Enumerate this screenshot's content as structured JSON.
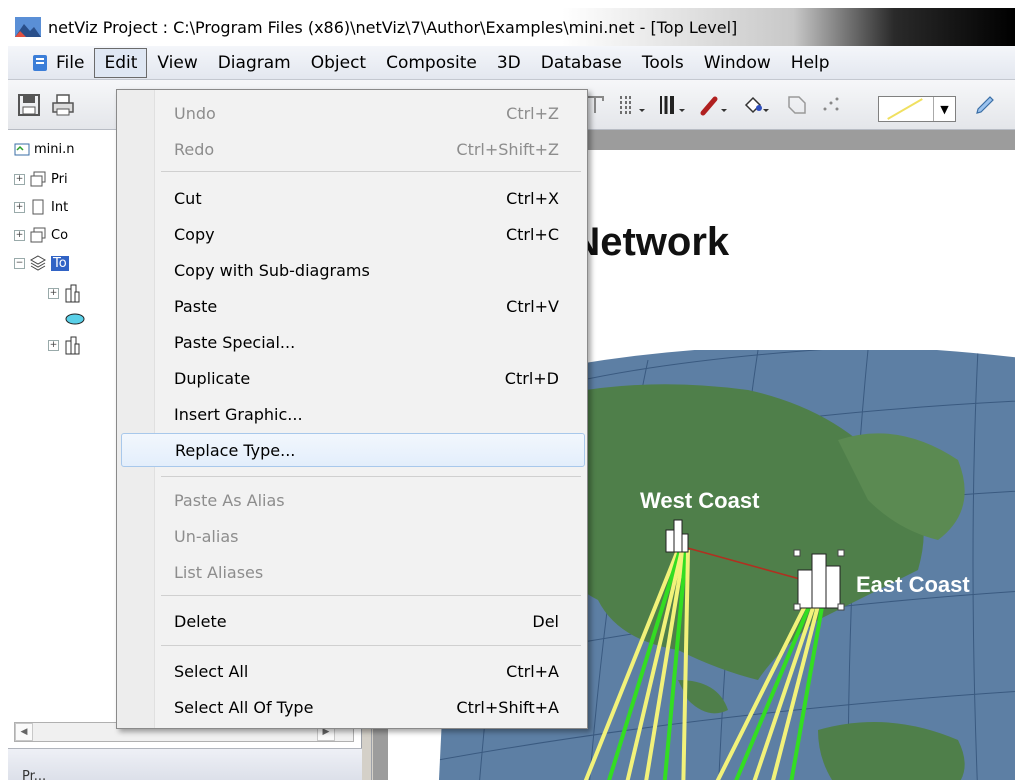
{
  "window": {
    "title": "netViz Project : C:\\Program Files (x86)\\netViz\\7\\Author\\Examples\\mini.net - [Top Level]"
  },
  "menubar": {
    "items": [
      "File",
      "Edit",
      "View",
      "Diagram",
      "Object",
      "Composite",
      "3D",
      "Database",
      "Tools",
      "Window",
      "Help"
    ],
    "open_item": "Edit"
  },
  "edit_menu": {
    "items": [
      {
        "label": "Undo",
        "shortcut": "Ctrl+Z",
        "enabled": false
      },
      {
        "label": "Redo",
        "shortcut": "Ctrl+Shift+Z",
        "enabled": false
      },
      {
        "label": "Cut",
        "shortcut": "Ctrl+X",
        "enabled": true
      },
      {
        "label": "Copy",
        "shortcut": "Ctrl+C",
        "enabled": true
      },
      {
        "label": "Copy with Sub-diagrams",
        "shortcut": "",
        "enabled": true
      },
      {
        "label": "Paste",
        "shortcut": "Ctrl+V",
        "enabled": true
      },
      {
        "label": "Paste Special...",
        "shortcut": "",
        "enabled": true
      },
      {
        "label": "Duplicate",
        "shortcut": "Ctrl+D",
        "enabled": true
      },
      {
        "label": "Insert Graphic...",
        "shortcut": "",
        "enabled": true
      },
      {
        "label": "Replace Type...",
        "shortcut": "",
        "enabled": true,
        "highlighted": true
      },
      {
        "label": "Paste As Alias",
        "shortcut": "",
        "enabled": false
      },
      {
        "label": "Un-alias",
        "shortcut": "",
        "enabled": false
      },
      {
        "label": "List Aliases",
        "shortcut": "",
        "enabled": false
      },
      {
        "label": "Delete",
        "shortcut": "Del",
        "enabled": true
      },
      {
        "label": "Select All",
        "shortcut": "Ctrl+A",
        "enabled": true
      },
      {
        "label": "Select All Of Type",
        "shortcut": "Ctrl+Shift+A",
        "enabled": true
      }
    ]
  },
  "tree": {
    "items": [
      {
        "label": "mini.n",
        "icon": "project-icon"
      },
      {
        "label": "Pri",
        "icon": "stack-icon"
      },
      {
        "label": "Int",
        "icon": "page-icon"
      },
      {
        "label": "Co",
        "icon": "stack-icon"
      },
      {
        "label": "To",
        "icon": "layers-icon",
        "selected": true
      },
      {
        "label": "",
        "icon": "building-icon"
      },
      {
        "label": "",
        "icon": "cloud-icon"
      },
      {
        "label": "",
        "icon": "building-icon"
      }
    ],
    "bottom_text": "Pr..."
  },
  "canvas": {
    "title": "obal Network",
    "west_label": "West Coast",
    "east_label": "East Coast"
  },
  "colors": {
    "selection": "#3163c5",
    "ocean": "#5d7fa4",
    "land": "#4f7f4a",
    "link_yellow": "#f2f27a",
    "link_green": "#33dd22",
    "link_red": "#b03020"
  }
}
